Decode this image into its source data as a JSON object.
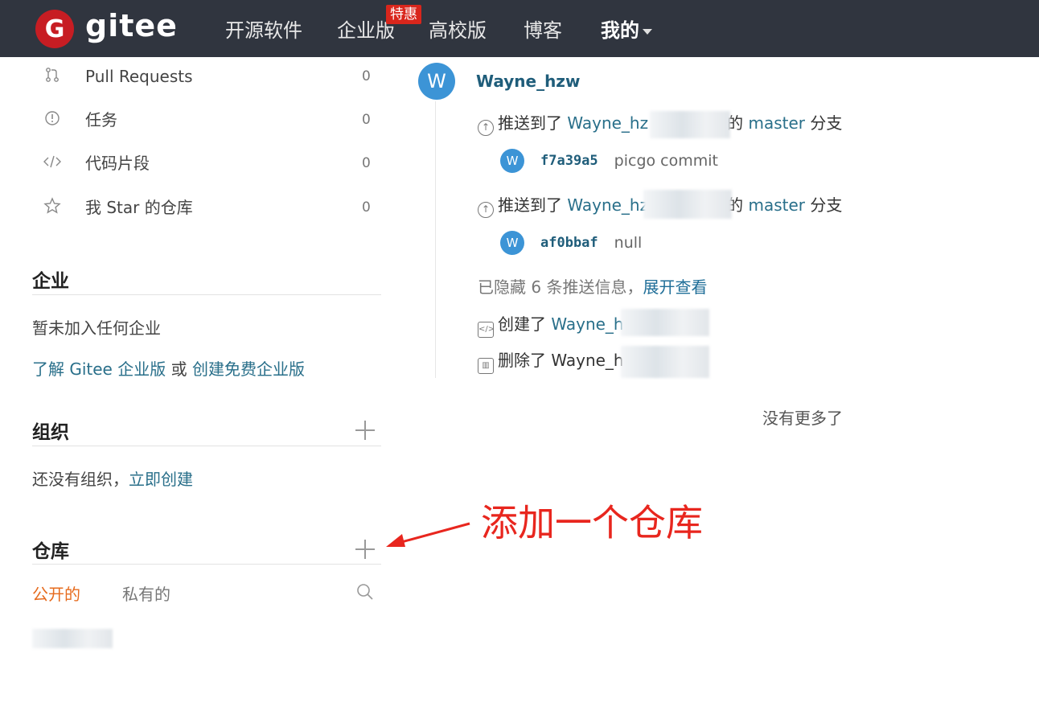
{
  "nav": {
    "logo_letter": "G",
    "logo_text": "gitee",
    "items": [
      "开源软件",
      "企业版",
      "高校版",
      "博客",
      "我的"
    ],
    "badge": "特惠"
  },
  "sidebar": {
    "items": [
      {
        "icon": "pull-request-icon",
        "label": "Pull Requests",
        "count": "0"
      },
      {
        "icon": "issue-icon",
        "label": "任务",
        "count": "0"
      },
      {
        "icon": "code-icon",
        "label": "代码片段",
        "count": "0"
      },
      {
        "icon": "star-icon",
        "label": "我 Star 的仓库",
        "count": "0"
      }
    ],
    "enterprise": {
      "title": "企业",
      "empty_text": "暂未加入任何企业",
      "learn_link": "了解 Gitee 企业版",
      "or_text": " 或 ",
      "create_link": "创建免费企业版"
    },
    "organization": {
      "title": "组织",
      "empty_text": "还没有组织，",
      "create_link": "立即创建"
    },
    "repository": {
      "title": "仓库",
      "tab_public": "公开的",
      "tab_private": "私有的"
    }
  },
  "feed": {
    "avatar_letter": "W",
    "user": "Wayne_hzw",
    "events": [
      {
        "prefix": "推送到了 ",
        "repo": "Wayne_hz",
        "suffix_mid": "的 ",
        "branch": "master",
        "suffix": " 分支"
      },
      {
        "prefix": "推送到了 ",
        "repo": "Wayne_hz",
        "suffix_mid": "的 ",
        "branch": "master",
        "suffix": " 分支"
      }
    ],
    "commits": [
      {
        "sha": "f7a39a5",
        "message": "picgo commit"
      },
      {
        "sha": "af0bbaf",
        "message": "null"
      }
    ],
    "hidden_text": "已隐藏 6 条推送信息，",
    "expand_link": "展开查看",
    "created_prefix": "创建了 ",
    "created_repo": "Wayne_h",
    "deleted_prefix": "删除了 ",
    "deleted_repo": "Wayne_h",
    "no_more": "没有更多了"
  },
  "annotation": {
    "text": "添加一个仓库",
    "color": "#e8261e"
  }
}
